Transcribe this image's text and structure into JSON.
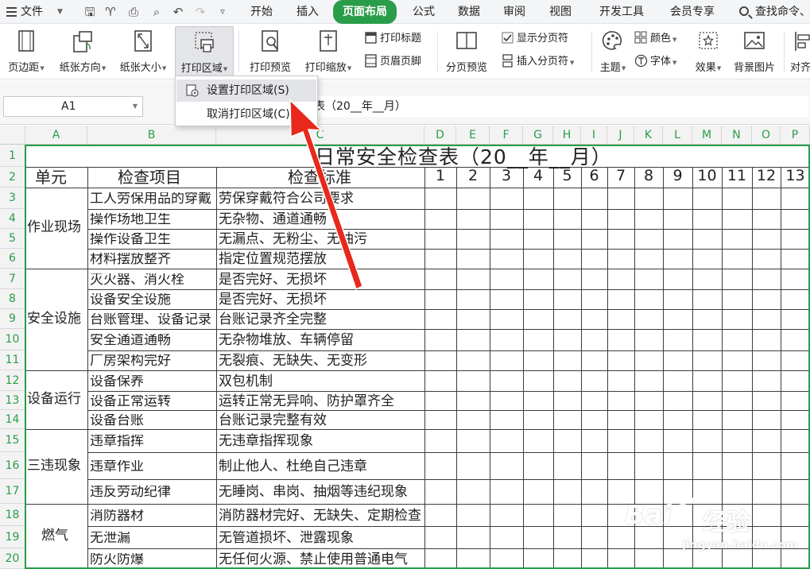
{
  "menubar": {
    "file_label": "文件",
    "tabs": [
      {
        "label": "开始"
      },
      {
        "label": "插入"
      },
      {
        "label": "页面布局"
      },
      {
        "label": "公式"
      },
      {
        "label": "数据"
      },
      {
        "label": "审阅"
      },
      {
        "label": "视图"
      },
      {
        "label": "开发工具"
      },
      {
        "label": "会员专享"
      }
    ],
    "active_tab": "页面布局",
    "search_label": "查找命令、"
  },
  "ribbon": {
    "margins": "页边距",
    "orientation": "纸张方向",
    "size": "纸张大小",
    "print_area": "打印区域",
    "print_preview": "打印预览",
    "print_scale": "打印缩放",
    "print_titles": "打印标题",
    "header_footer": "页眉页脚",
    "page_break_preview": "分页预览",
    "show_page_breaks": "显示分页符",
    "insert_page_break": "插入分页符",
    "theme": "主题",
    "colors": "颜色",
    "fonts": "字体",
    "effects": "效果",
    "background": "背景图片",
    "align": "对齐"
  },
  "namebox": {
    "value": "A1"
  },
  "formula": {
    "value": "表（20__年__月）"
  },
  "dropdown": {
    "set_print_area": "设置打印区域(S)",
    "cancel_print_area": "取消打印区域(C)"
  },
  "columns": [
    "A",
    "B",
    "C",
    "D",
    "E",
    "F",
    "G",
    "H",
    "I",
    "J",
    "K",
    "L",
    "M",
    "N",
    "O",
    "P"
  ],
  "rows": [
    "1",
    "2",
    "3",
    "4",
    "5",
    "6",
    "7",
    "8",
    "9",
    "10",
    "11",
    "12",
    "13",
    "14",
    "15",
    "16",
    "17",
    "18",
    "19",
    "20"
  ],
  "sheet": {
    "title": "日常安全检查表（20__年__月）",
    "header": {
      "unit": "单元",
      "item": "检查项目",
      "standard": "检查标准"
    },
    "days": [
      "1",
      "2",
      "3",
      "4",
      "5",
      "6",
      "7",
      "8",
      "9",
      "10",
      "11",
      "12",
      "13"
    ],
    "units": [
      "作业现场",
      "安全设施",
      "设备运行",
      "三违现象",
      "燃气"
    ],
    "items": [
      "工人劳保用品的穿戴",
      "操作场地卫生",
      "操作设备卫生",
      "材料摆放整齐",
      "灭火器、消火栓",
      "设备安全设施",
      "台账管理、设备记录",
      "安全通道通畅",
      "厂房架构完好",
      "设备保养",
      "设备正常运转",
      "设备台账",
      "违章指挥",
      "违章作业",
      "违反劳动纪律",
      "消防器材",
      "无泄漏",
      "防火防爆"
    ],
    "standards": [
      "劳保穿戴符合公司要求",
      "无杂物、通道通畅",
      "无漏点、无粉尘、无油污",
      "指定位置规范摆放",
      "是否完好、无损坏",
      "是否完好、无损坏",
      "台账记录齐全完整",
      "无杂物堆放、车辆停留",
      "无裂痕、无缺失、无变形",
      "双包机制",
      "运转正常无异响、防护罩齐全",
      "台账记录完整有效",
      "无违章指挥现象",
      "制止他人、杜绝自己违章",
      "无睡岗、串岗、抽烟等违纪现象",
      "消防器材完好、无缺失、定期检查",
      "无管道损坏、泄露现象",
      "无任何火源、禁止使用普通电气"
    ]
  },
  "watermark": {
    "brand": "Bai",
    "suffix": "经验",
    "url": "jingyan.baidu.com"
  },
  "colors": {
    "accent": "#2a9d49",
    "arrow": "#e8281c"
  }
}
